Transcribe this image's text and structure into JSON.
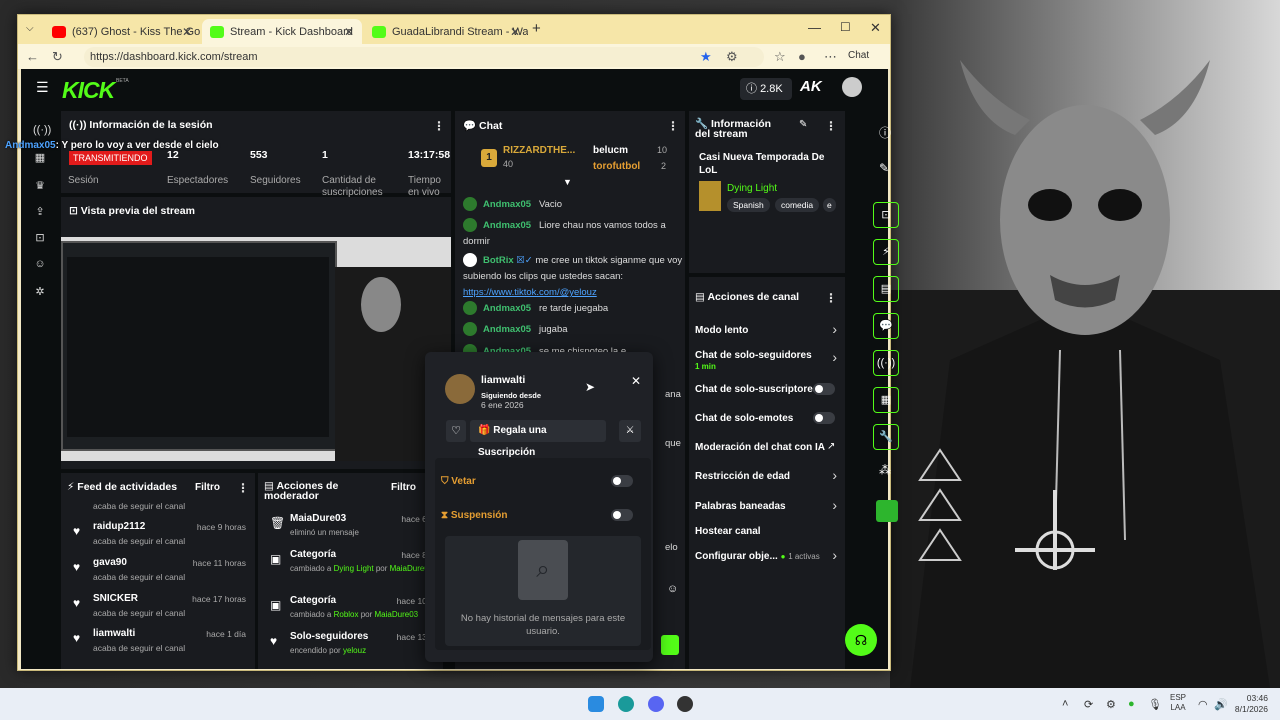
{
  "browser": {
    "tabs": [
      {
        "label": "(637) Ghost - Kiss The Go-Go",
        "icon": "youtube-icon"
      },
      {
        "label": "Stream - Kick Dashboard",
        "icon": "kick-icon"
      },
      {
        "label": "GuadaLibrandi Stream - Watc",
        "icon": "kick-icon"
      }
    ],
    "url": "https://dashboard.kick.com/stream",
    "chat_button": "Chat"
  },
  "kick": {
    "logo": "KICK",
    "logo_badge": "BETA",
    "viewer_pill": "2.8K"
  },
  "overlay_chat": {
    "user": "Andmax05",
    "text": ": Y pero lo voy a ver desde el cielo"
  },
  "session": {
    "title": "Información de la sesión",
    "status": "TRANSMITIENDO",
    "viewers": "12",
    "followers": "553",
    "subs": "1",
    "time": "13:17:58",
    "labels": [
      "Sesión",
      "Espectadores",
      "Seguidores",
      "Cantidad de suscripciones",
      "Tiempo en vivo"
    ]
  },
  "preview": {
    "title": "Vista previa del stream"
  },
  "chat": {
    "title": "Chat",
    "leaders": [
      {
        "rank": "1",
        "name": "RIZZARDTHE...",
        "points": "40"
      },
      {
        "name": "belucm",
        "points": "10"
      },
      {
        "name": "torofutbol",
        "points": "2"
      }
    ],
    "messages": [
      {
        "user": "Andmax05",
        "text": "Vacio"
      },
      {
        "user": "Andmax05",
        "text": "Liore chau nos vamos todos a dormir"
      },
      {
        "user": "BotRix",
        "text": "me cree un tiktok siganme que voy subiendo los clips que ustedes sacan:"
      },
      {
        "link": "https://www.tiktok.com/@yelouz"
      },
      {
        "user": "Andmax05",
        "text": "re tarde juegaba"
      },
      {
        "user": "Andmax05",
        "text": "jugaba"
      },
      {
        "user": "Andmax05",
        "text": "se me chispoteo la e"
      }
    ],
    "partial": [
      "ana",
      "que",
      "elo"
    ]
  },
  "stream_info": {
    "title": "Información del stream",
    "stream_title": "Casi Nueva Temporada De LoL",
    "game": "Dying Light",
    "tags": [
      "Spanish",
      "comedia",
      "e"
    ]
  },
  "channel_actions": {
    "title": "Acciones de canal",
    "items": [
      {
        "label": "Modo lento"
      },
      {
        "label": "Chat de solo-seguidores",
        "sub": "1 min"
      },
      {
        "label": "Chat de solo-suscriptores"
      },
      {
        "label": "Chat de solo-emotes"
      },
      {
        "label": "Moderación del chat con IA"
      },
      {
        "label": "Restricción de edad"
      },
      {
        "label": "Palabras baneadas"
      },
      {
        "label": "Hostear canal"
      },
      {
        "label": "Configurar obje...",
        "sub": "1 activas"
      }
    ]
  },
  "activity_feed": {
    "title": "Feed de actividades",
    "filter": "Filtro",
    "top_sub": "acaba de seguir el canal",
    "items": [
      {
        "name": "raidup2112",
        "time": "hace 9 horas",
        "sub": "acaba de seguir el canal"
      },
      {
        "name": "gava90",
        "time": "hace 11 horas",
        "sub": "acaba de seguir el canal"
      },
      {
        "name": "SNICKER",
        "time": "hace 17 horas",
        "sub": "acaba de seguir el canal"
      },
      {
        "name": "liamwalti",
        "time": "hace 1 día",
        "sub": "acaba de seguir el canal"
      }
    ]
  },
  "mod_actions": {
    "title": "Acciones de moderador",
    "filter": "Filtro",
    "items": [
      {
        "name": "MaiaDure03",
        "time": "hace 6 h",
        "sub": "eliminó un mensaje"
      },
      {
        "name": "Categoría",
        "time": "hace 8 h",
        "sub_a": "cambiado a ",
        "sub_b": "Dying Light",
        "sub_c": " por ",
        "sub_d": "MaiaDure03"
      },
      {
        "name": "Categoría",
        "time": "hace 10 h",
        "sub_a": "cambiado a ",
        "sub_b": "Roblox",
        "sub_c": " por ",
        "sub_d": "MaiaDure03"
      },
      {
        "name": "Solo-seguidores",
        "time": "hace 13 h",
        "sub_a": "encendido por ",
        "sub_b": "yelouz"
      }
    ]
  },
  "popup": {
    "username": "liamwalti",
    "following_label": "Siguiendo desde",
    "following_date": "6 ene 2026",
    "gift_button": "Regala una Suscripción",
    "ban_label": "Vetar",
    "timeout_label": "Suspensión",
    "empty_text": "No hay historial de mensajes para este usuario."
  },
  "taskbar": {
    "lang1": "ESP",
    "lang2": "LAA",
    "time": "03:46",
    "date": "8/1/2026"
  },
  "colors": {
    "brand": "#53fc18",
    "panel": "#191b1f",
    "link": "#4da3ff"
  }
}
